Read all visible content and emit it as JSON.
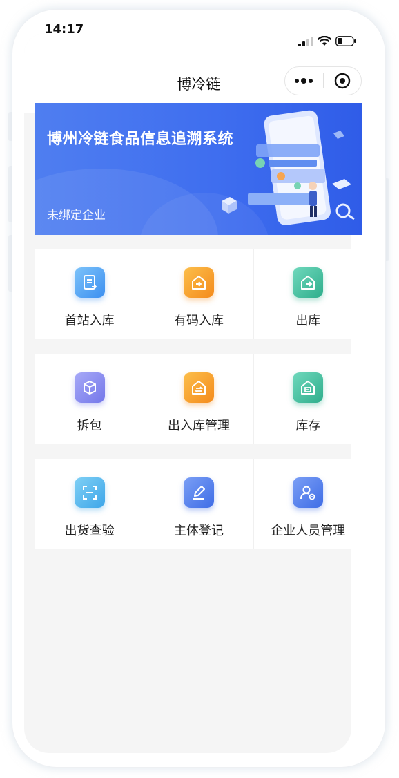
{
  "status_bar": {
    "time": "14:17"
  },
  "nav": {
    "title": "博冷链"
  },
  "banner": {
    "title": "博州冷链食品信息追溯系统",
    "subtitle": "未绑定企业"
  },
  "grid": [
    {
      "label": "首站入库",
      "icon": "receipt-icon",
      "color_from": "#7cc3fa",
      "color_to": "#3c8ff0"
    },
    {
      "label": "有码入库",
      "icon": "house-arrow-in-icon",
      "color_from": "#fcbe4a",
      "color_to": "#f48b1c"
    },
    {
      "label": "出库",
      "icon": "house-arrow-out-icon",
      "color_from": "#6fd8bc",
      "color_to": "#2fae8c"
    },
    {
      "label": "拆包",
      "icon": "box-icon",
      "color_from": "#a7a9f7",
      "color_to": "#7477ea"
    },
    {
      "label": "出入库管理",
      "icon": "house-exchange-icon",
      "color_from": "#fcbe4a",
      "color_to": "#f48b1c"
    },
    {
      "label": "库存",
      "icon": "warehouse-icon",
      "color_from": "#6fd8bc",
      "color_to": "#2fae8c"
    },
    {
      "label": "出货查验",
      "icon": "scan-icon",
      "color_from": "#7fd0f5",
      "color_to": "#3ea6e9"
    },
    {
      "label": "主体登记",
      "icon": "pen-edit-icon",
      "color_from": "#7a9ef5",
      "color_to": "#3f6de6"
    },
    {
      "label": "企业人员管理",
      "icon": "user-settings-icon",
      "color_from": "#7a9ef5",
      "color_to": "#3f6de6"
    }
  ]
}
